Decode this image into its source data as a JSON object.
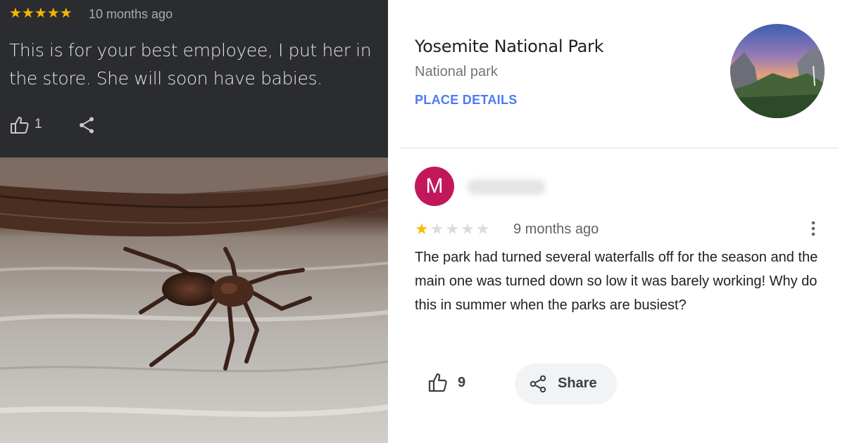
{
  "left_review": {
    "rating": 5,
    "stars_text": "★★★★★",
    "time": "10 months ago",
    "text": "This is for your best employee, I put her in the store. She will soon have babies.",
    "likes": "1",
    "like_icon": "thumbs-up-icon",
    "share_icon": "share-icon",
    "photo": "spider-on-wood-photo"
  },
  "place": {
    "name": "Yosemite National Park",
    "type": "National park",
    "details_link": "PLACE DETAILS",
    "thumbnail": "yosemite-valley-photo"
  },
  "right_review": {
    "avatar_letter": "M",
    "avatar_color": "#c2185b",
    "rating": 1,
    "stars_filled": "★",
    "stars_empty": "★★★★",
    "time": "9 months ago",
    "text": "The park had turned several waterfalls off for the season and the main one was turned down so low it was barely working!  Why do this in summer when the parks are busiest?",
    "likes": "9",
    "share_label": "Share",
    "more_icon": "more-vert-icon"
  },
  "colors": {
    "dark_panel": "#2b2c30",
    "star_gold": "#fbbc04",
    "link_blue": "#4b7bf0"
  }
}
